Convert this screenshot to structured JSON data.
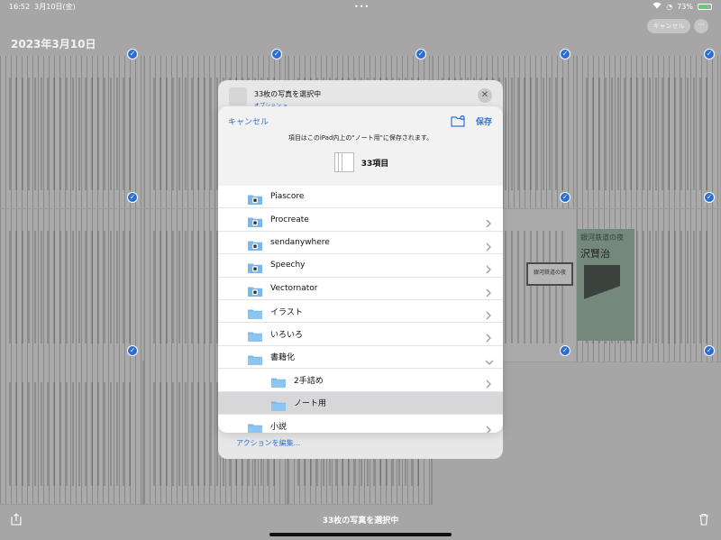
{
  "status_bar": {
    "time": "16:52",
    "date": "3月10日(金)",
    "battery": "73%"
  },
  "header": {
    "date_title": "2023年3月10日",
    "cancel_label": "キャンセル",
    "more_label": "···"
  },
  "share_sheet": {
    "title": "33枚の写真を選択中",
    "options_label": "オプション >",
    "close_label": "✕",
    "edit_actions_label": "アクションを編集..."
  },
  "save_dialog": {
    "cancel_label": "キャンセル",
    "save_label": "保存",
    "info_text": "項目はこのiPad内上の\"ノート用\"に保存されます。",
    "item_count": "33項目"
  },
  "folders": [
    {
      "name": "Piascore",
      "type": "app",
      "chevron": "none"
    },
    {
      "name": "Procreate",
      "type": "app",
      "chevron": "right"
    },
    {
      "name": "sendanywhere",
      "type": "app",
      "chevron": "right"
    },
    {
      "name": "Speechy",
      "type": "app",
      "chevron": "right"
    },
    {
      "name": "Vectornator",
      "type": "app",
      "chevron": "right"
    },
    {
      "name": "イラスト",
      "type": "folder",
      "chevron": "right"
    },
    {
      "name": "いろいろ",
      "type": "folder",
      "chevron": "right"
    },
    {
      "name": "書籍化",
      "type": "folder",
      "chevron": "down"
    },
    {
      "name": "2手詰め",
      "type": "subfolder",
      "chevron": "right"
    },
    {
      "name": "ノート用",
      "type": "subfolder",
      "chevron": "none",
      "selected": true
    },
    {
      "name": "小説",
      "type": "folder",
      "chevron": "right"
    }
  ],
  "background": {
    "book_title": "銀河鉄道の夜",
    "book_author": "沢賢治",
    "label_box_text": "銀河鉄道の夜"
  },
  "toolbar": {
    "selection_title": "33枚の写真を選択中"
  },
  "colors": {
    "accent": "#2f72d8",
    "folder": "#7cb7ec",
    "selected_row": "#d7d7da"
  }
}
